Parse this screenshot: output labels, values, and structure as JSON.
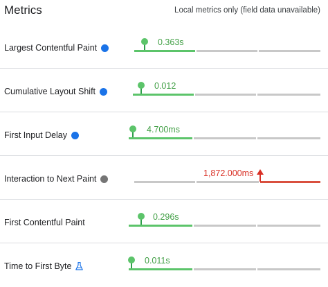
{
  "header": {
    "title": "Metrics",
    "subtitle": "Local metrics only (field data unavailable)"
  },
  "colors": {
    "good": "#43a047",
    "good_bar": "#5cc46a",
    "poor": "#d93025",
    "poor_bar": "#d9503f",
    "track": "#c8c8c8",
    "dot_blue": "#1a73e8",
    "dot_gray": "#757575",
    "flask": "#1a73e8"
  },
  "metrics": [
    {
      "label": "Largest Contentful Paint",
      "icon": "blue-dot-icon",
      "value": "0.363s",
      "status": "good"
    },
    {
      "label": "Cumulative Layout Shift",
      "icon": "blue-dot-icon",
      "value": "0.012",
      "status": "good"
    },
    {
      "label": "First Input Delay",
      "icon": "blue-dot-icon",
      "value": "4.700ms",
      "status": "good"
    },
    {
      "label": "Interaction to Next Paint",
      "icon": "gray-dot-icon",
      "value": "1,872.000ms",
      "status": "poor"
    },
    {
      "label": "First Contentful Paint",
      "icon": null,
      "value": "0.296s",
      "status": "good"
    },
    {
      "label": "Time to First Byte",
      "icon": "flask-icon",
      "value": "0.011s",
      "status": "good"
    }
  ]
}
